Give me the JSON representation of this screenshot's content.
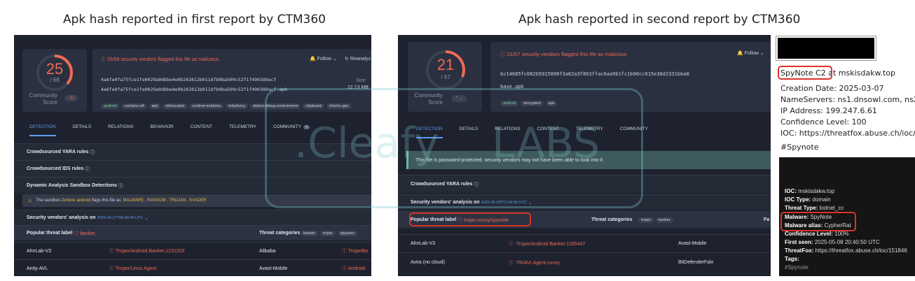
{
  "captions": {
    "left": "Apk hash reported in first report by CTM360",
    "right": "Apk hash reported in second report by CTM360"
  },
  "colors": {
    "accent_red": "#f06a55",
    "accent_blue": "#5b9cf0",
    "panel_bg": "#1e222e",
    "highlight_box": "#d9342b"
  },
  "report1": {
    "score": "25",
    "score_den": "/ 68",
    "community_label": "Community Score",
    "community_value": "-11",
    "alert": "25/68 security vendors flagged this file as malicious",
    "follow": "Follow",
    "reanalyze": "Reanalyz",
    "hash": "4a6fe0fa75fce1fe0029a0dbbe4e0b263812b011dfb0ba509c52f1f490389acf",
    "filename": "4a6fe0fa75fce1fe0029a0dbbe4e0b263812b011dfb0ba509c52f1f490389acf.apk",
    "size_label": "Size",
    "size_value": "22.13 MB",
    "tags": [
      "android",
      "contains-elf",
      "apk",
      "obfuscated",
      "runtime-modules",
      "telephony",
      "detect-debug-environment",
      "clipboard",
      "checks-gps"
    ],
    "tabs": [
      "DETECTION",
      "DETAILS",
      "RELATIONS",
      "BEHAVIOR",
      "CONTENT",
      "TELEMETRY",
      "COMMUNITY"
    ],
    "community_badge": "4",
    "rows": [
      "Crowdsourced YARA rules",
      "Crowdsourced IDS rules",
      "Dynamic Analysis Sandbox Detections"
    ],
    "sandbox_prefix": "The sandbox",
    "sandbox_name": "Zenbox android",
    "sandbox_mid": "flags this file as:",
    "sandbox_flags": "MALWARE , RANSOM , TROJAN , EVADER",
    "vendors_title": "Security vendors' analysis on",
    "vendors_date": "2025-03-27T08:48:49 UTC",
    "popular_label": "Popular threat label",
    "popular_value": "banker.",
    "threat_cat_label": "Threat categories",
    "threat_cats": [
      "banker",
      "trojan",
      "spyware"
    ],
    "vendors": [
      {
        "name": "AhnLab-V3",
        "result": "Trojan/Android.Banker.1231203",
        "name2": "Alibaba",
        "result2": "TrojanBa"
      },
      {
        "name": "Antiy-AVL",
        "result": "Trojan/Linux.Agent",
        "name2": "Avast-Mobile",
        "result2": "Android:"
      }
    ]
  },
  "report2": {
    "score": "21",
    "score_den": "/ 67",
    "community_label": "Community Score",
    "alert": "21/67 security vendors flagged this file as malicious",
    "follow": "Follow",
    "hash": "bc14685fc082b5015008f3a62a3f863ffac6aa9b1fc1b90cc615e36d2331bba0",
    "filename": "base.apk",
    "tags": [
      "android",
      "encrypted",
      "apk"
    ],
    "tabs": [
      "DETECTION",
      "DETAILS",
      "RELATIONS",
      "CONTENT",
      "TELEMETRY",
      "COMMUNITY"
    ],
    "note": "This file is password-protected, security vendors may not have been able to look into it",
    "yara": "Crowdsourced YARA rules",
    "vendors_title": "Security vendors' analysis on",
    "vendors_date": "2025-05-03T11:54:58 UTC",
    "popular_label": "Popular threat label",
    "popular_value": "trojan.nvvsy/spynote",
    "threat_cat_label": "Threat categories",
    "threat_cats": [
      "trojan",
      "banker"
    ],
    "fa": "Fa",
    "vendors": [
      {
        "name": "AhnLab-V3",
        "result": "Trojan/Android.Banker.1285447",
        "name2": "Avast-Mobile"
      },
      {
        "name": "Avira (no cloud)",
        "result": "TR/AVI.Agent.nvvsy",
        "name2": "BitDefenderFalx"
      }
    ]
  },
  "intel": {
    "spynote_prefix": "SpyNote C2",
    "spynote_suffix": " at mskisdakw.top",
    "creation": "Creation Date: 2025-03-07",
    "nameservers": "NameServers: ns1.dnsowl.com, ns2.dnsow",
    "ip": "IP Address: 199.247.6.61",
    "confidence": "Confidence Level: 100",
    "ioc_link": "IOC: https://threatfox.abuse.ch/ioc/15184",
    "hashtag": "#Spynote"
  },
  "intel2": {
    "ioc_label": "IOC:",
    "ioc": "mskisdakw.top",
    "ioc_type_label": "IOC Type:",
    "ioc_type": "domain",
    "threat_type_label": "Threat Type:",
    "threat_type": "botnet_cc",
    "malware_label": "Malware:",
    "malware": "SpyNote",
    "alias_label": "Malware alias:",
    "alias": "CypherRat",
    "conf_label": "Confidence Level:",
    "conf": "100%",
    "first_label": "First seen:",
    "first": "2025-05-08 20:40:50 UTC",
    "tf_label": "ThreatFox:",
    "tf": "https://threatfox.abuse.ch/ioc/151846",
    "tags_label": "Tags:",
    "tag": "#Spynote"
  },
  "watermark": {
    "left": ".Cleafy",
    "right": "LABS"
  }
}
